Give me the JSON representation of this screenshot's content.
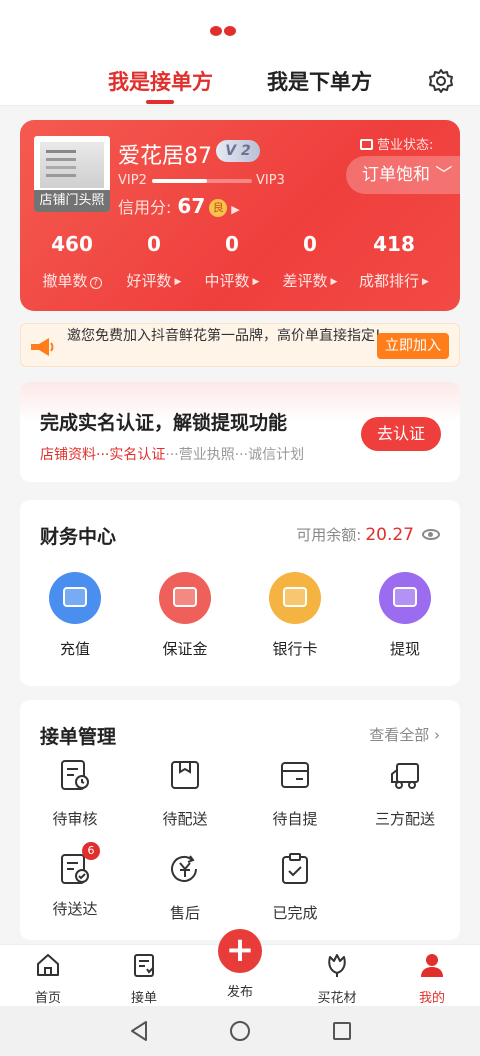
{
  "tabs": {
    "receiver": "我是接单方",
    "sender": "我是下单方"
  },
  "shop": {
    "photo_label": "店铺门头照",
    "name": "爱花居87",
    "vip_badge": "V 2",
    "vip_from": "VIP2",
    "vip_to": "VIP3",
    "vip_progress": 0.55,
    "credit_label": "信用分:",
    "credit_score": "67",
    "credit_grade": "良",
    "status_label": "营业状态:",
    "status_value": "订单饱和"
  },
  "stats": [
    {
      "value": "460",
      "label": "撤单数"
    },
    {
      "value": "0",
      "label": "好评数"
    },
    {
      "value": "0",
      "label": "中评数"
    },
    {
      "value": "0",
      "label": "差评数"
    },
    {
      "value": "418",
      "label": "成都排行"
    }
  ],
  "promo": {
    "text": "邀您免费加入抖音鲜花第一品牌，高价单直接指定!",
    "button": "立即加入"
  },
  "verify": {
    "title": "完成实名认证，解锁提现功能",
    "step1": "店铺资料",
    "step2": "实名认证",
    "step3": "营业执照",
    "step4": "诚信计划",
    "sep": "···",
    "button": "去认证"
  },
  "finance": {
    "title": "财务中心",
    "balance_label": "可用余额:",
    "balance_value": "20.27",
    "items": [
      {
        "label": "充值",
        "color": "#4a8ff0"
      },
      {
        "label": "保证金",
        "color": "#f0605a"
      },
      {
        "label": "银行卡",
        "color": "#f5b342"
      },
      {
        "label": "提现",
        "color": "#9b6cf0"
      }
    ]
  },
  "orders": {
    "title": "接单管理",
    "view_all": "查看全部",
    "items": [
      {
        "label": "待审核"
      },
      {
        "label": "待配送"
      },
      {
        "label": "待自提"
      },
      {
        "label": "三方配送"
      },
      {
        "label": "待送达",
        "badge": "6"
      },
      {
        "label": "售后"
      },
      {
        "label": "已完成"
      }
    ]
  },
  "nav": {
    "home": "首页",
    "orders": "接单",
    "publish": "发布",
    "flowers": "买花材",
    "mine": "我的",
    "active_color": "#e0302d"
  }
}
